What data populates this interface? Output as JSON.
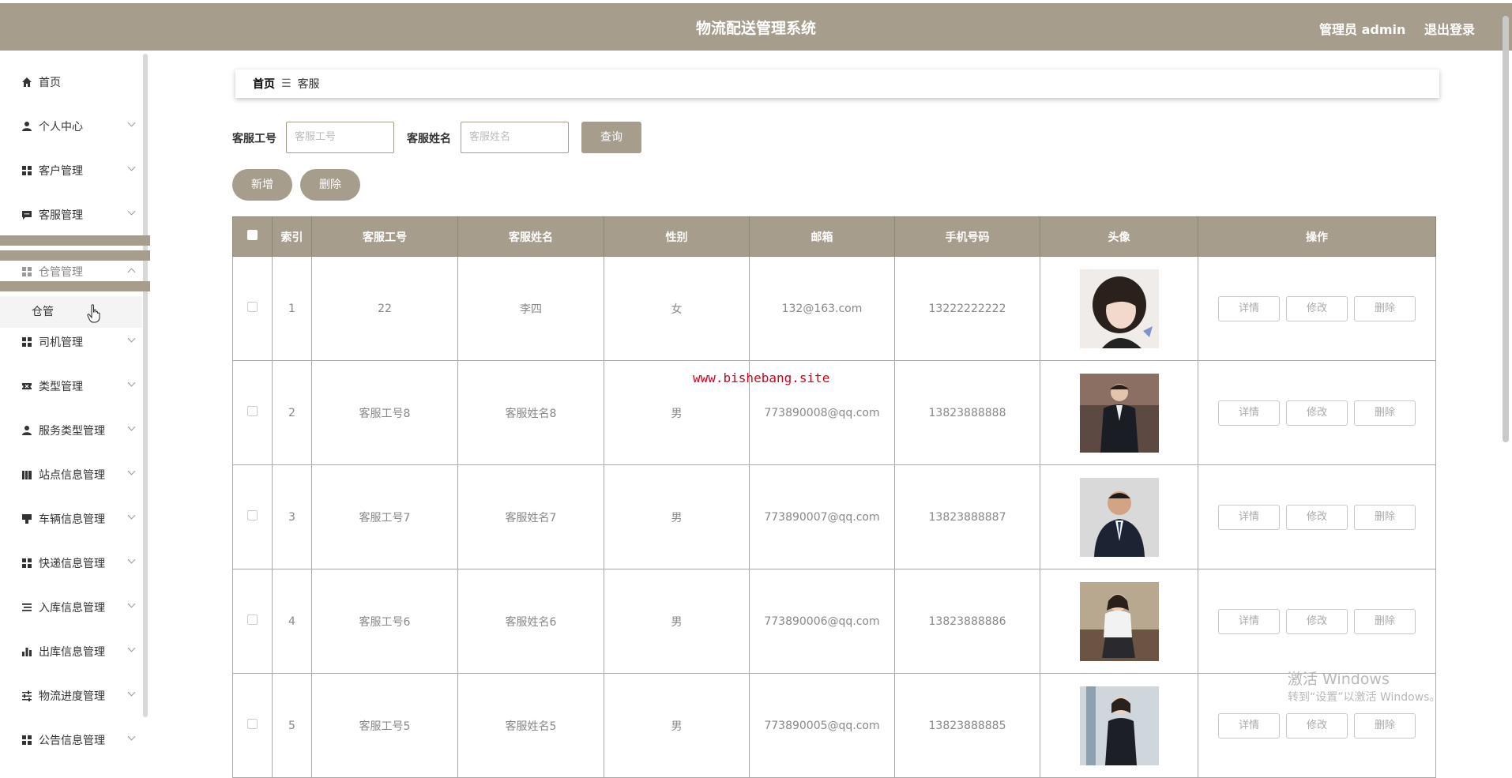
{
  "header": {
    "title": "物流配送管理系统",
    "user": "管理员 admin",
    "logout": "退出登录"
  },
  "sidebar": {
    "items": [
      {
        "label": "首页",
        "icon": "home-icon"
      },
      {
        "label": "个人中心",
        "icon": "user-icon"
      },
      {
        "label": "客户管理",
        "icon": "grid-icon"
      },
      {
        "label": "客服管理",
        "icon": "chat-icon"
      },
      {
        "label": "仓管管理",
        "icon": "grid-icon"
      },
      {
        "label": "司机管理",
        "icon": "grid-icon"
      },
      {
        "label": "类型管理",
        "icon": "ticket-icon"
      },
      {
        "label": "服务类型管理",
        "icon": "user-icon"
      },
      {
        "label": "站点信息管理",
        "icon": "book-icon"
      },
      {
        "label": "车辆信息管理",
        "icon": "truck-icon"
      },
      {
        "label": "快递信息管理",
        "icon": "grid-icon"
      },
      {
        "label": "入库信息管理",
        "icon": "list-icon"
      },
      {
        "label": "出库信息管理",
        "icon": "bar-chart-icon"
      },
      {
        "label": "物流进度管理",
        "icon": "sliders-icon"
      },
      {
        "label": "公告信息管理",
        "icon": "grid-icon"
      }
    ],
    "sub_item": "仓管"
  },
  "breadcrumb": {
    "home": "首页",
    "separator": "☰",
    "current": "客服"
  },
  "search": {
    "id_label": "客服工号",
    "id_placeholder": "客服工号",
    "name_label": "客服姓名",
    "name_placeholder": "客服姓名",
    "query": "查询"
  },
  "actions": {
    "add": "新增",
    "delete": "删除"
  },
  "table": {
    "headers": [
      "索引",
      "客服工号",
      "客服姓名",
      "性别",
      "邮箱",
      "手机号码",
      "头像",
      "操作"
    ],
    "rows": [
      {
        "index": "1",
        "id": "22",
        "name": "李四",
        "gender": "女",
        "email": "132@163.com",
        "phone": "13222222222"
      },
      {
        "index": "2",
        "id": "客服工号8",
        "name": "客服姓名8",
        "gender": "男",
        "email": "773890008@qq.com",
        "phone": "13823888888"
      },
      {
        "index": "3",
        "id": "客服工号7",
        "name": "客服姓名7",
        "gender": "男",
        "email": "773890007@qq.com",
        "phone": "13823888887"
      },
      {
        "index": "4",
        "id": "客服工号6",
        "name": "客服姓名6",
        "gender": "男",
        "email": "773890006@qq.com",
        "phone": "13823888886"
      },
      {
        "index": "5",
        "id": "客服工号5",
        "name": "客服姓名5",
        "gender": "男",
        "email": "773890005@qq.com",
        "phone": "13823888885"
      }
    ],
    "ops": {
      "detail": "详情",
      "edit": "修改",
      "delete": "删除"
    }
  },
  "watermark": "www.bishebang.site",
  "windows": {
    "line1": "激活 Windows",
    "line2": "转到“设置”以激活 Windows。"
  },
  "colors": {
    "accent": "#a69d8c"
  }
}
